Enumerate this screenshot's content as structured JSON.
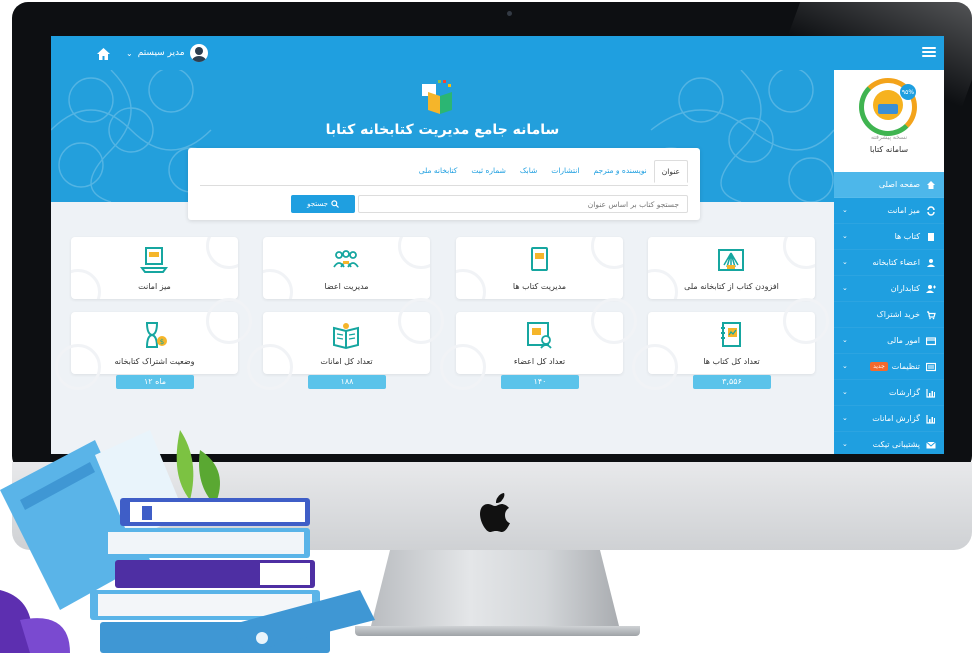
{
  "topbar": {
    "user_name": "مدیر سیستم",
    "chevron": "⌄",
    "icons": {
      "menu": "hamburger-icon",
      "home": "home-icon",
      "user": "user-avatar-icon"
    }
  },
  "sidebar": {
    "logo_tag": "نسخه پیشرفته",
    "logo_badge": "۹۵%",
    "logo_name": "سامانه کتابا",
    "items": [
      {
        "label": "صفحه اصلی",
        "icon": "home-icon"
      },
      {
        "label": "میز امانت",
        "icon": "exchange-icon"
      },
      {
        "label": "کتاب ها",
        "icon": "book-icon"
      },
      {
        "label": "اعضاء کتابخانه",
        "icon": "user-icon"
      },
      {
        "label": "کتابداران",
        "icon": "users-icon"
      },
      {
        "label": "خرید اشتراک",
        "icon": "cart-icon"
      },
      {
        "label": "امور مالی",
        "icon": "credit-card-icon"
      },
      {
        "label": "تنظیمات",
        "icon": "settings-icon",
        "badge": "جدید"
      },
      {
        "label": "گزارشات",
        "icon": "bar-chart-icon"
      },
      {
        "label": "گزارش امانات",
        "icon": "bar-chart-icon"
      },
      {
        "label": "پشتیبانی تیکت",
        "icon": "envelope-icon"
      }
    ]
  },
  "banner": {
    "title": "سامانه جامع مدیریت کتابخانه کتابا"
  },
  "search": {
    "tabs": [
      "عنوان",
      "نویسنده و مترجم",
      "انتشارات",
      "شابک",
      "شماره ثبت",
      "کتابخانه ملی"
    ],
    "placeholder": "جستجو کتاب بر اساس عنوان",
    "button_label": "جستجو"
  },
  "cards_row1": [
    {
      "label": "افزودن کتاب از کتابخانه ملی",
      "icon": "national-library-icon"
    },
    {
      "label": "مدیریت کتاب ها",
      "icon": "book-manage-icon"
    },
    {
      "label": "مدیریت اعضا",
      "icon": "members-icon"
    },
    {
      "label": "میز امانت",
      "icon": "loan-desk-icon"
    }
  ],
  "cards_row2": [
    {
      "label": "تعداد کل کتاب ها",
      "value": "۳,۵۵۶",
      "icon": "books-count-icon"
    },
    {
      "label": "تعداد کل اعضاء",
      "value": "۱۴۰",
      "icon": "members-count-icon"
    },
    {
      "label": "تعداد کل امانات",
      "value": "۱۸۸",
      "icon": "loans-count-icon"
    },
    {
      "label": "وضعیت اشتراک کتابخانه",
      "value": "۱۲ ماه",
      "icon": "subscription-icon"
    }
  ],
  "colors": {
    "primary": "#1f9fe0",
    "value_chip": "#5bc3ea",
    "badge": "#f46a2d",
    "icon_teal": "#16a6a0"
  }
}
